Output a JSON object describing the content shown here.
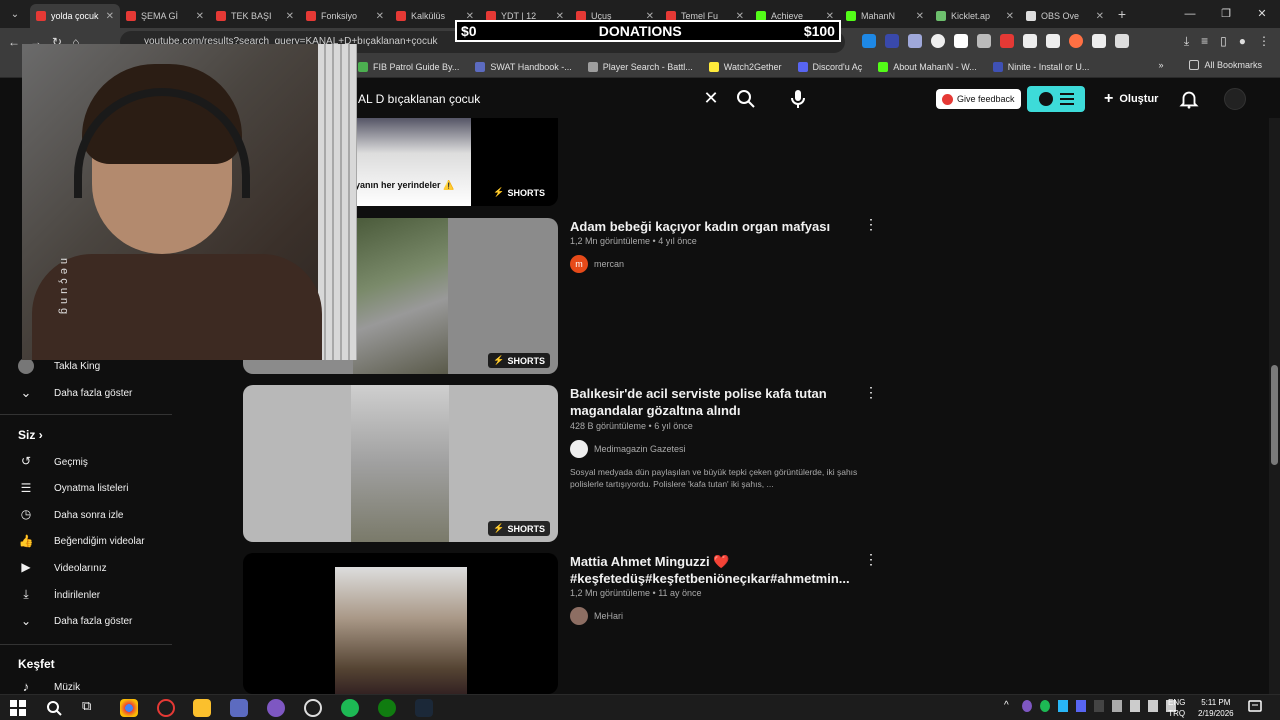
{
  "browser": {
    "tabs": [
      {
        "label": "yolda çocuk",
        "active": true,
        "color": "#e53935"
      },
      {
        "label": "ŞEMA Gİ",
        "active": false,
        "color": "#e53935"
      },
      {
        "label": "TEK BAŞI",
        "active": false,
        "color": "#e53935"
      },
      {
        "label": "Fonksiyo",
        "active": false,
        "color": "#e53935"
      },
      {
        "label": "Kalkülüs",
        "active": false,
        "color": "#e53935"
      },
      {
        "label": "YDT | 12",
        "active": false,
        "color": "#e53935"
      },
      {
        "label": "Uçuş",
        "active": false,
        "color": "#e53935"
      },
      {
        "label": "Temel Fu",
        "active": false,
        "color": "#e53935"
      },
      {
        "label": "Achieve",
        "active": false,
        "color": "#53fc18"
      },
      {
        "label": "MahanN",
        "active": false,
        "color": "#53fc18"
      },
      {
        "label": "Kicklet.ap",
        "active": false,
        "color": "#6dbf6d"
      },
      {
        "label": "OBS Ove",
        "active": false,
        "color": "#dddddd"
      }
    ],
    "url": "youtube.com/results?search_query=KANAL+D+bıçaklanan+çocuk",
    "bookmarks": [
      {
        "label": "FIB Patrol Guide By...",
        "color": "#4caf50"
      },
      {
        "label": "SWAT Handbook -...",
        "color": "#5c6bc0"
      },
      {
        "label": "Player Search - Battl...",
        "color": "#9e9e9e"
      },
      {
        "label": "Watch2Gether",
        "color": "#ffeb3b"
      },
      {
        "label": "Discord'u Aç",
        "color": "#5865f2"
      },
      {
        "label": "About MahanN - W...",
        "color": "#53fc18"
      },
      {
        "label": "Ninite - Install or U...",
        "color": "#3f51b5"
      }
    ],
    "all_bookmarks": "All Bookmarks"
  },
  "overlay": {
    "donation_min": "$0",
    "donation_label": "DONATIONS",
    "donation_max": "$100",
    "webcam_watermark": "neçung"
  },
  "header": {
    "search_value": "AL D bıçaklanan çocuk",
    "feedback_label": "Give feedback",
    "create_label": "Oluştur"
  },
  "sidebar": {
    "items_top": [
      {
        "label": "Takla King"
      },
      {
        "label": "Daha fazla göster"
      }
    ],
    "you_heading": "Siz",
    "you_items": [
      {
        "label": "Geçmiş",
        "icon": "history-icon"
      },
      {
        "label": "Oynatma listeleri",
        "icon": "playlist-icon"
      },
      {
        "label": "Daha sonra izle",
        "icon": "clock-icon"
      },
      {
        "label": "Beğendiğim videolar",
        "icon": "thumbs-up-icon"
      },
      {
        "label": "Videolarınız",
        "icon": "video-icon"
      },
      {
        "label": "İndirilenler",
        "icon": "download-icon"
      },
      {
        "label": "Daha fazla göster",
        "icon": "chevron-down-icon"
      }
    ],
    "explore_heading": "Keşfet",
    "explore_items": [
      {
        "label": "Müzik",
        "icon": "music-icon"
      }
    ]
  },
  "results": [
    {
      "partial_caption": "yanın her yerindeler ⚠️",
      "badge": "SHORTS"
    },
    {
      "title": "Adam bebeği kaçıyor kadın organ mafyası",
      "meta": "1,2 Mn görüntüleme • 4 yıl önce",
      "channel": "mercan",
      "channel_color": "#e64a19",
      "channel_initial": "m",
      "badge": "SHORTS"
    },
    {
      "title": "Balıkesir'de acil serviste polise kafa tutan magandalar gözaltına alındı",
      "meta": "428 B görüntüleme • 6 yıl önce",
      "channel": "Medimagazin Gazetesi",
      "channel_color": "#eeeeee",
      "description": "Sosyal medyada dün paylaşılan ve büyük tepki çeken görüntülerde, iki şahıs polislerle tartışıyordu. Polislere 'kafa tutan' iki şahıs, ...",
      "badge": "SHORTS"
    },
    {
      "title": "Mattia Ahmet Minguzzi ❤️ #keşfetedüş#keşfetbeniöneçıkar#ahmetmin...",
      "meta": "1,2 Mn görüntüleme • 11 ay önce",
      "channel": "MeHari",
      "channel_color": "#8d6e63"
    }
  ],
  "taskbar": {
    "lang_top": "ENG",
    "lang_bottom": "TRQ",
    "time": "5:11 PM",
    "date": "2/19/2026"
  }
}
